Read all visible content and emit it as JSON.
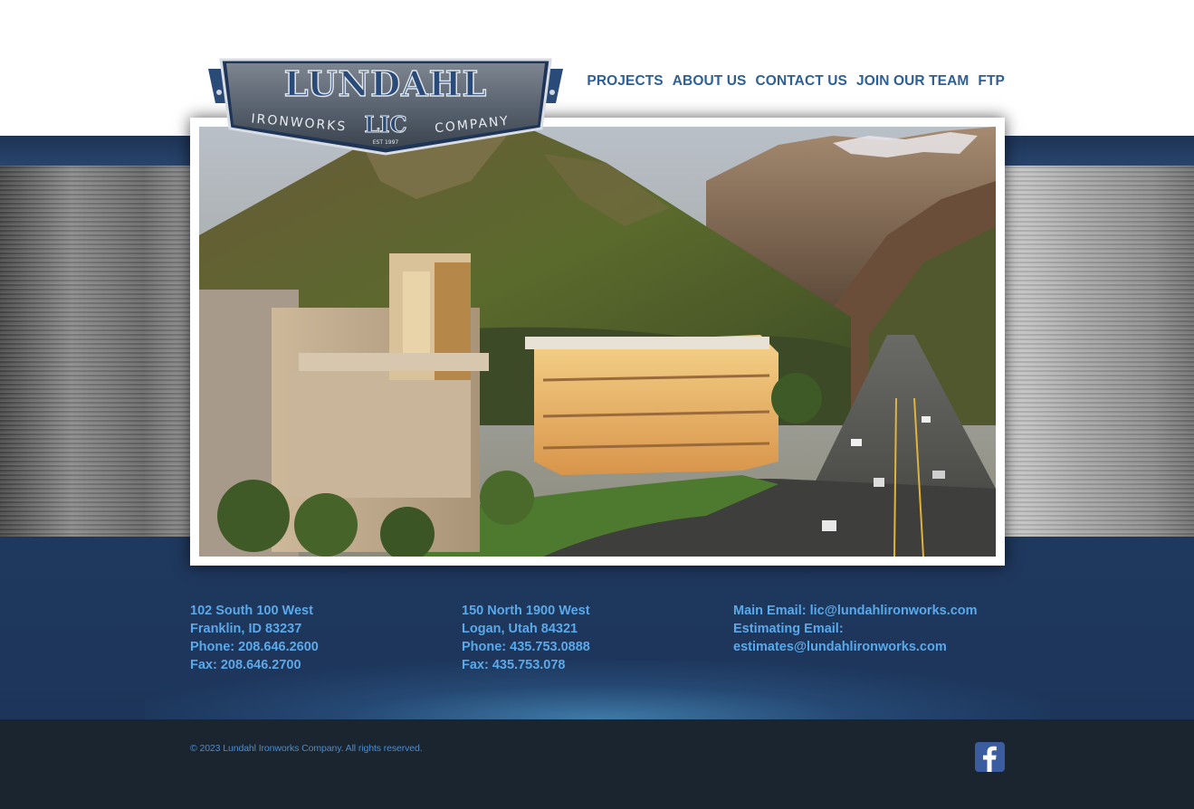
{
  "brand": {
    "name": "LUNDAHL",
    "left_word": "IRONWORKS",
    "monogram": "LIC",
    "right_word": "COMPANY",
    "established": "EST 1997"
  },
  "nav": [
    {
      "label": "PROJECTS"
    },
    {
      "label": "ABOUT US"
    },
    {
      "label": "CONTACT US"
    },
    {
      "label": "JOIN OUR TEAM"
    },
    {
      "label": "FTP"
    }
  ],
  "locations": [
    {
      "address_line1": "102 South 100 West",
      "address_line2": "Franklin, ID 83237",
      "phone": "Phone: 208.646.2600",
      "fax": "Fax: 208.646.2700"
    },
    {
      "address_line1": "150 North 1900 West",
      "address_line2": "Logan, Utah 84321",
      "phone": "Phone: 435.753.0888",
      "fax": "Fax: 435.753.078"
    }
  ],
  "emails": {
    "main": "Main Email: lic@lundahlironworks.com",
    "estimating_label": "Estimating Email:",
    "estimating": "estimates@lundahlironworks.com"
  },
  "footer": {
    "copyright": "© 2023 Lundahl Ironworks Company. All rights reserved."
  },
  "social": [
    {
      "icon": "facebook-icon"
    }
  ],
  "colors": {
    "nav_text": "#2e5f95",
    "contact_text": "#5aa9ea",
    "navy_band": "#213b62",
    "footer_bg": "#1b2530",
    "facebook_blue": "#3b5c9e"
  }
}
